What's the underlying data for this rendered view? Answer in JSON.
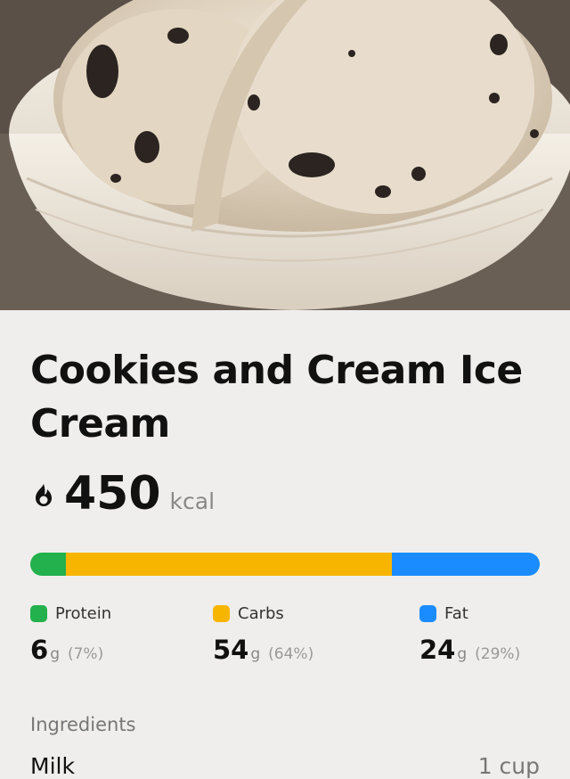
{
  "hero": {
    "image_alt": "Cookies and Cream Ice Cream photo"
  },
  "title": "Cookies and Cream Ice Cream",
  "calories": {
    "value": "450",
    "unit": "kcal",
    "icon": "flame-icon"
  },
  "macros_bar": {
    "segments": [
      {
        "name": "Protein",
        "fraction": 0.07,
        "color": "#22b14c"
      },
      {
        "name": "Carbs",
        "fraction": 0.64,
        "color": "#f7b500"
      },
      {
        "name": "Fat",
        "fraction": 0.29,
        "color": "#1a8cff"
      }
    ]
  },
  "macros": [
    {
      "name": "Protein",
      "value": "6",
      "unit": "g",
      "percent": "(7%)",
      "color": "#22b14c"
    },
    {
      "name": "Carbs",
      "value": "54",
      "unit": "g",
      "percent": "(64%)",
      "color": "#f7b500"
    },
    {
      "name": "Fat",
      "value": "24",
      "unit": "g",
      "percent": "(29%)",
      "color": "#1a8cff"
    }
  ],
  "ingredients": {
    "label": "Ingredients",
    "items": [
      {
        "name": "Milk",
        "quantity": "1 cup"
      }
    ]
  }
}
